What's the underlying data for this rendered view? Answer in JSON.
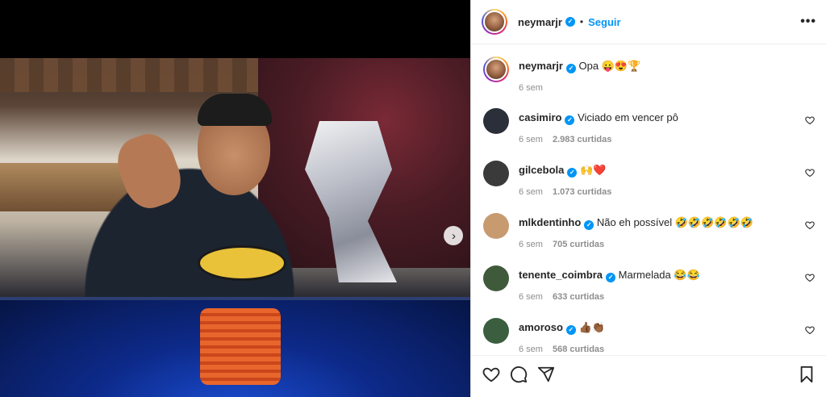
{
  "post": {
    "author": "neymarjr",
    "follow_label": "Seguir",
    "separator": "•",
    "more_label": "•••",
    "next_label": "›"
  },
  "caption": {
    "user": "neymarjr",
    "text": "Opa 😛😍🏆",
    "time": "6 sem"
  },
  "comments": [
    {
      "user": "casimiro",
      "verified": true,
      "text": "Viciado em vencer pô",
      "time": "6 sem",
      "likes": "2.983 curtidas",
      "avatar_color": "#2b2f3a"
    },
    {
      "user": "gilcebola",
      "verified": true,
      "text": "🙌❤️",
      "time": "6 sem",
      "likes": "1.073 curtidas",
      "avatar_color": "#3a3a3a"
    },
    {
      "user": "mlkdentinho",
      "verified": true,
      "text": "Não eh possível 🤣🤣🤣🤣🤣🤣",
      "time": "6 sem",
      "likes": "705 curtidas",
      "avatar_color": "#c79a70"
    },
    {
      "user": "tenente_coimbra",
      "verified": true,
      "text": "Marmelada 😂😂",
      "time": "6 sem",
      "likes": "633 curtidas",
      "avatar_color": "#3f5a3b"
    },
    {
      "user": "amoroso",
      "verified": true,
      "text": "👍🏾👏🏾",
      "time": "6 sem",
      "likes": "568 curtidas",
      "avatar_color": "#3b5e3e"
    }
  ],
  "icons": {
    "like": "heart-icon",
    "comment": "comment-icon",
    "share": "share-icon",
    "save": "bookmark-icon",
    "verified": "verified-icon"
  },
  "colors": {
    "link": "#0095f6",
    "verified": "#0095f6",
    "muted": "#8e8e8e"
  }
}
